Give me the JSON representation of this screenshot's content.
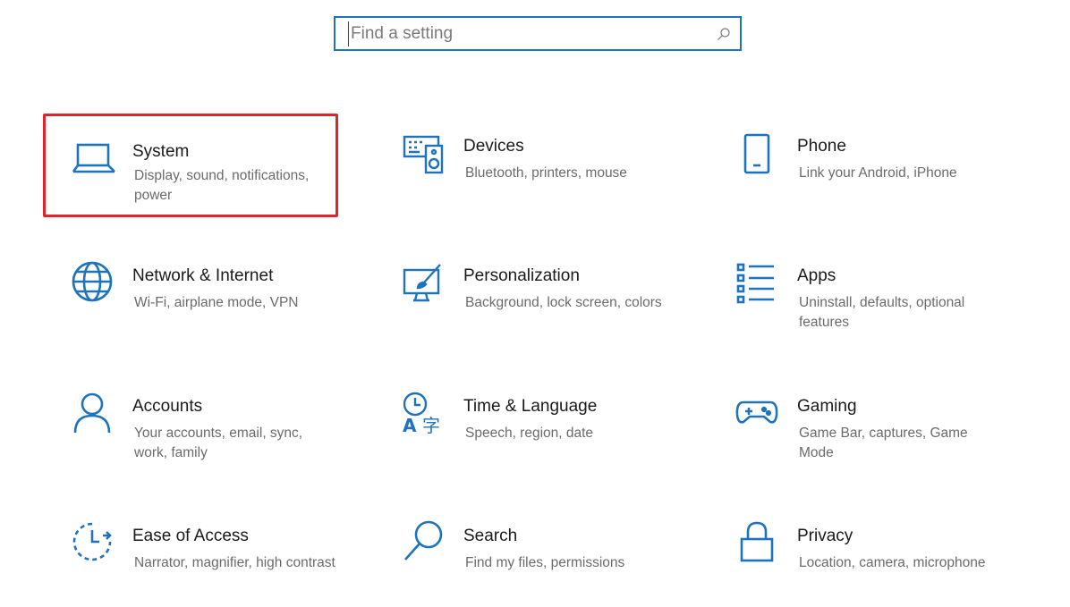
{
  "search": {
    "placeholder": "Find a setting",
    "icon": "search-icon"
  },
  "accent_color": "#1e73be",
  "highlight_color": "#e0242c",
  "tiles": [
    {
      "title": "System",
      "desc": "Display, sound, notifications, power",
      "icon": "laptop-icon",
      "highlighted": true
    },
    {
      "title": "Devices",
      "desc": "Bluetooth, printers, mouse",
      "icon": "keyboard-speaker-icon"
    },
    {
      "title": "Phone",
      "desc": "Link your Android, iPhone",
      "icon": "phone-icon"
    },
    {
      "title": "Network & Internet",
      "desc": "Wi-Fi, airplane mode, VPN",
      "icon": "globe-icon"
    },
    {
      "title": "Personalization",
      "desc": "Background, lock screen, colors",
      "icon": "paintbrush-icon"
    },
    {
      "title": "Apps",
      "desc": "Uninstall, defaults, optional features",
      "icon": "apps-list-icon"
    },
    {
      "title": "Accounts",
      "desc": "Your accounts, email, sync, work, family",
      "icon": "person-icon"
    },
    {
      "title": "Time & Language",
      "desc": "Speech, region, date",
      "icon": "time-language-icon"
    },
    {
      "title": "Gaming",
      "desc": "Game Bar, captures, Game Mode",
      "icon": "gamepad-icon"
    },
    {
      "title": "Ease of Access",
      "desc": "Narrator, magnifier, high contrast",
      "icon": "ease-of-access-icon"
    },
    {
      "title": "Search",
      "desc": "Find my files, permissions",
      "icon": "magnifier-icon"
    },
    {
      "title": "Privacy",
      "desc": "Location, camera, microphone",
      "icon": "lock-icon"
    }
  ]
}
